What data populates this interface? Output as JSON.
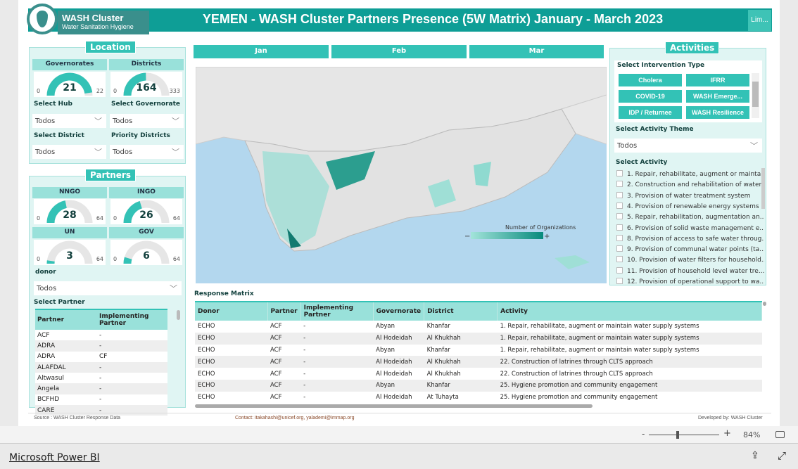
{
  "header": {
    "logo_title": "WASH Cluster",
    "logo_subtitle": "Water Sanitation Hygiene",
    "title": "YEMEN - WASH Cluster Partners Presence (5W Matrix) January - March 2023",
    "lim_button": "Lim..."
  },
  "colors": {
    "accent": "#33c2b6",
    "header": "#0e9e96",
    "panel": "#e0f5f3"
  },
  "location": {
    "title": "Location",
    "kpis": [
      {
        "label": "Governorates",
        "value": 21,
        "min": 0,
        "max": 22
      },
      {
        "label": "Districts",
        "value": 164,
        "min": 0,
        "max": 333
      }
    ],
    "filters": [
      {
        "label": "Select Hub",
        "value": "Todos"
      },
      {
        "label": "Select Governorate",
        "value": "Todos"
      },
      {
        "label": "Select District",
        "value": "Todos"
      },
      {
        "label": "Priority Districts",
        "value": "Todos"
      }
    ]
  },
  "partners": {
    "title": "Partners",
    "kpis": [
      {
        "label": "NNGO",
        "value": 28,
        "min": 0,
        "max": 64
      },
      {
        "label": "INGO",
        "value": 26,
        "min": 0,
        "max": 64
      },
      {
        "label": "UN",
        "value": 3,
        "min": 0,
        "max": 64
      },
      {
        "label": "GOV",
        "value": 6,
        "min": 0,
        "max": 64
      }
    ],
    "donor_label": "donor",
    "donor_value": "Todos",
    "select_partner_label": "Select Partner",
    "table_headers": [
      "Partner",
      "Implementing Partner"
    ],
    "rows": [
      [
        "ACF",
        "-"
      ],
      [
        "ADRA",
        "-"
      ],
      [
        "ADRA",
        "CF"
      ],
      [
        "ALAFDAL",
        "-"
      ],
      [
        "Altwasul",
        "-"
      ],
      [
        "Angela",
        "-"
      ],
      [
        "BCFHD",
        "-"
      ],
      [
        "CARE",
        "-"
      ]
    ]
  },
  "months": [
    "Jan",
    "Feb",
    "Mar"
  ],
  "map": {
    "legend_title": "Number of Organizations",
    "legend_min": "−",
    "legend_max": "+"
  },
  "activities": {
    "title": "Activities",
    "intervention_label": "Select Intervention Type",
    "intervention_types": [
      "Cholera",
      "IFRR",
      "COVID-19",
      "WASH Emerge...",
      "IDP / Returnee",
      "WASH Resilience"
    ],
    "theme_label": "Select Activity Theme",
    "theme_value": "Todos",
    "activity_label": "Select Activity",
    "items": [
      "1. Repair, rehabilitate, augment or maintai...",
      "2. Construction and rehabilitation of water...",
      "3. Provision of water treatment system",
      "4. Provision of renewable energy systems ...",
      "5. Repair, rehabilitation, augmentation an...",
      "6. Provision of solid waste management e...",
      "8. Provision of access to safe water throug...",
      "9. Provision of communal water points (ta...",
      "10. Provision of water filters for household...",
      "11. Provision of household level water tre...",
      "12. Provision of operational support to wa..."
    ]
  },
  "matrix": {
    "title": "Response Matrix",
    "headers": [
      "Donor",
      "Partner",
      "Implementing Partner",
      "Governorate",
      "District",
      "Activity"
    ],
    "rows": [
      [
        "ECHO",
        "ACF",
        "-",
        "Abyan",
        "Khanfar",
        "1. Repair, rehabilitate, augment or maintain water supply systems"
      ],
      [
        "ECHO",
        "ACF",
        "-",
        "Al Hodeidah",
        "Al Khukhah",
        "1. Repair, rehabilitate, augment or maintain water supply systems"
      ],
      [
        "ECHO",
        "ACF",
        "-",
        "Abyan",
        "Khanfar",
        "1. Repair, rehabilitate, augment or maintain water supply systems"
      ],
      [
        "ECHO",
        "ACF",
        "-",
        "Al Hodeidah",
        "Al Khukhah",
        "22. Construction of latrines through CLTS approach"
      ],
      [
        "ECHO",
        "ACF",
        "-",
        "Al Hodeidah",
        "Al Khukhah",
        "22. Construction of latrines through CLTS approach"
      ],
      [
        "ECHO",
        "ACF",
        "-",
        "Abyan",
        "Khanfar",
        "25. Hygiene promotion and community engagement"
      ],
      [
        "ECHO",
        "ACF",
        "-",
        "Al Hodeidah",
        "At Tuhayta",
        "25. Hygiene promotion and community engagement"
      ]
    ]
  },
  "footer": {
    "source": "Source : WASH Cluster Response Data",
    "contact": "Contact: itakahashi@unicef.org, yalademi@immap.org",
    "developed": "Developed by: WASH Cluster"
  },
  "zoom": {
    "minus": "-",
    "plus": "+",
    "level": "84%",
    "value": 84
  },
  "bottom": {
    "brand": "Microsoft Power BI"
  }
}
